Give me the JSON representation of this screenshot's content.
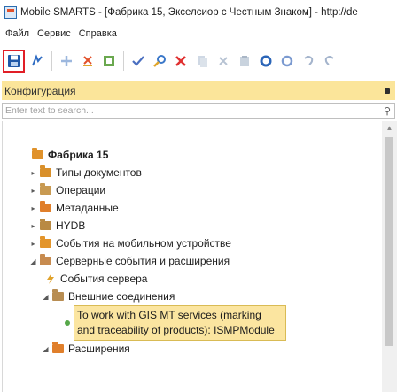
{
  "window": {
    "title": "Mobile SMARTS - [Фабрика 15, Экселсиор с Честным Знаком] - http://de"
  },
  "menu": {
    "items": [
      "Файл",
      "Сервис",
      "Справка"
    ]
  },
  "toolbar": {
    "buttons": [
      "save-icon",
      "flash-icon",
      "add-icon",
      "delete-icon",
      "refresh-icon",
      "check-icon",
      "find-icon",
      "remove-icon",
      "copy-icon",
      "cut-icon",
      "paste-icon",
      "circle-icon",
      "circle-outline-icon",
      "undo-icon",
      "redo-icon"
    ]
  },
  "panel": {
    "title": "Конфигурация"
  },
  "search": {
    "placeholder": "Enter text to search..."
  },
  "tree": {
    "root": "Фабрика 15",
    "items": [
      {
        "label": "Типы документов",
        "color": "#d9902b"
      },
      {
        "label": "Операции",
        "color": "#c89a52"
      },
      {
        "label": "Метаданные",
        "color": "#e07f2b"
      },
      {
        "label": "HYDB",
        "color": "#b98a43"
      },
      {
        "label": "События на мобильном устройстве",
        "color": "#e3952b"
      },
      {
        "label": "Серверные события и расширения",
        "color": "#c78b4f"
      }
    ],
    "server_events": "События сервера",
    "external_connections": "Внешние соединения",
    "selected": "To work with GIS MT services (marking and traceability of products): ISMPModule",
    "extensions": "Расширения"
  },
  "colors": {
    "panel_header": "#fbe59a",
    "selection": "#fbe5a0",
    "save_highlight": "#e11e26"
  }
}
